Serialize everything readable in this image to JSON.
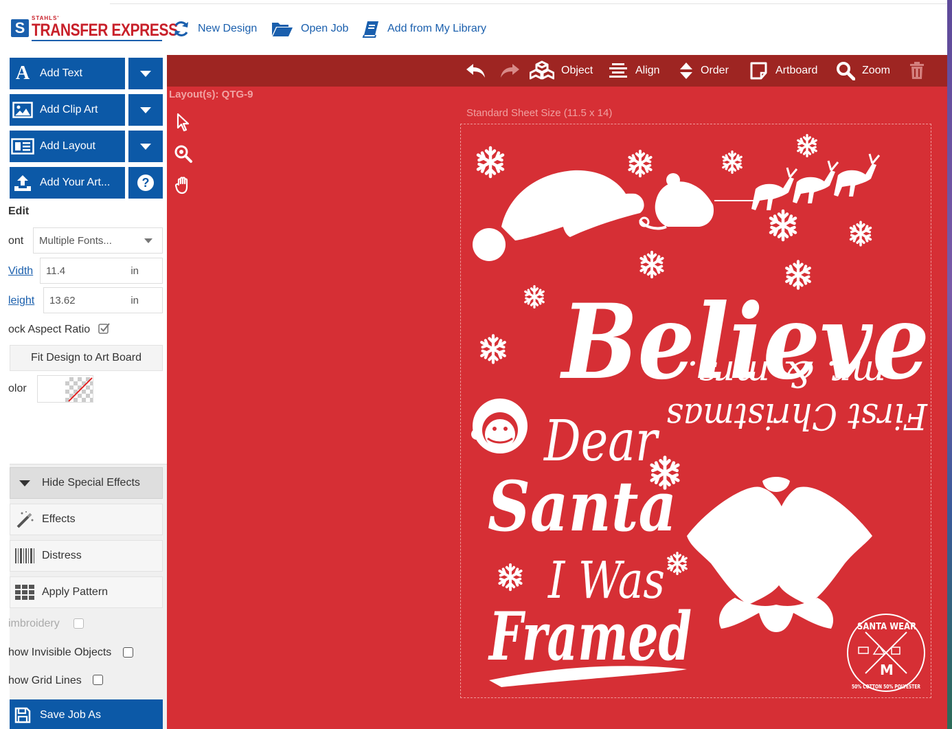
{
  "logo": {
    "brand_small": "STAHLS'",
    "brand": "TRANSFER EXPRESS"
  },
  "topnav": {
    "new_design": "New Design",
    "open_job": "Open Job",
    "add_library": "Add from My Library"
  },
  "sidebar": {
    "add_text": "Add Text",
    "add_clip_art": "Add Clip Art",
    "add_layout": "Add Layout",
    "add_your_art": "Add Your Art...",
    "help": "?",
    "edit_heading": "Edit",
    "font_label": "ont",
    "font_value": "Multiple Fonts...",
    "width_label": "Vidth",
    "width_value": "11.4",
    "width_unit": "in",
    "height_label": "leight",
    "height_value": "13.62",
    "height_unit": "in",
    "lock_aspect": "ock Aspect Ratio",
    "lock_aspect_checked": true,
    "fit_design": "Fit Design to Art Board",
    "color_label": "olor",
    "hide_effects": "Hide Special Effects",
    "effects": "Effects",
    "distress": "Distress",
    "apply_pattern": "Apply Pattern",
    "embroidery": "imbroidery",
    "show_invisible": "how Invisible Objects",
    "show_grid": "how Grid Lines",
    "save_job": "Save Job As"
  },
  "toolbar": {
    "object": "Object",
    "align": "Align",
    "order": "Order",
    "artboard": "Artboard",
    "zoom": "Zoom"
  },
  "canvas": {
    "layout_label": "Layout(s): QTG-9",
    "sheet_label": "Standard Sheet Size (11.5 x 14)"
  },
  "artwork": {
    "believe": "Believe",
    "dear": "Dear",
    "santa": "Santa",
    "i_was": "I Was",
    "framed": "Framed",
    "mirrored_line1": "First Christmas",
    "mirrored_line2": "mr. & mrs.",
    "badge_top": "SANTA WEAR",
    "badge_letter": "M",
    "badge_bottom": "50% COTTON 50% POLYESTER"
  },
  "colors": {
    "brand_blue": "#0c59a7",
    "brand_red": "#c8202a",
    "canvas_red": "#d62f35",
    "toolbar_red": "#9e2522"
  }
}
